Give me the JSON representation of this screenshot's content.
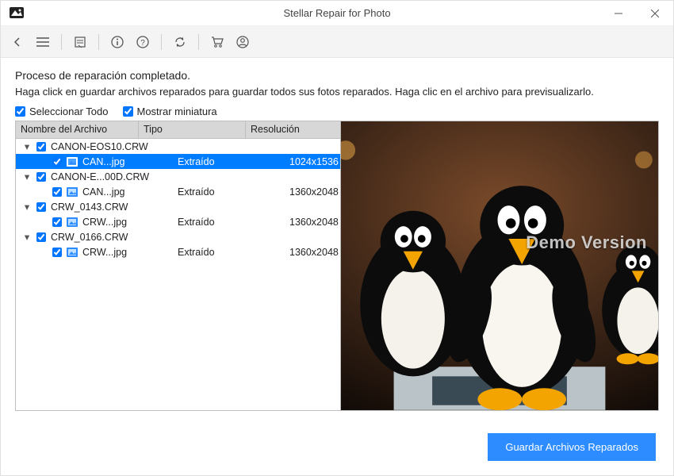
{
  "titlebar": {
    "title": "Stellar Repair for Photo"
  },
  "status": {
    "heading": "Proceso de reparación completado.",
    "instructions": "Haga click en guardar archivos reparados para guardar todos sus fotos reparados. Haga clic en el archivo para previsualizarlo."
  },
  "options": {
    "select_all_label": "Seleccionar Todo",
    "select_all_checked": true,
    "show_thumb_label": "Mostrar miniatura",
    "show_thumb_checked": true
  },
  "columns": {
    "name": "Nombre del Archivo",
    "type": "Tipo",
    "resolution": "Resolución"
  },
  "tree": [
    {
      "group": "CANON-EOS10.CRW",
      "expanded": true,
      "checked": true,
      "children": [
        {
          "name": "CAN...jpg",
          "type": "Extraído",
          "resolution": "1024x1536",
          "checked": true,
          "selected": true
        }
      ]
    },
    {
      "group": "CANON-E...00D.CRW",
      "expanded": true,
      "checked": true,
      "children": [
        {
          "name": "CAN...jpg",
          "type": "Extraído",
          "resolution": "1360x2048",
          "checked": true,
          "selected": false
        }
      ]
    },
    {
      "group": "CRW_0143.CRW",
      "expanded": true,
      "checked": true,
      "children": [
        {
          "name": "CRW...jpg",
          "type": "Extraído",
          "resolution": "1360x2048",
          "checked": true,
          "selected": false
        }
      ]
    },
    {
      "group": "CRW_0166.CRW",
      "expanded": true,
      "checked": true,
      "children": [
        {
          "name": "CRW...jpg",
          "type": "Extraído",
          "resolution": "1360x2048",
          "checked": true,
          "selected": false
        }
      ]
    }
  ],
  "preview": {
    "watermark": "Demo Version"
  },
  "footer": {
    "save_button": "Guardar Archivos Reparados"
  }
}
